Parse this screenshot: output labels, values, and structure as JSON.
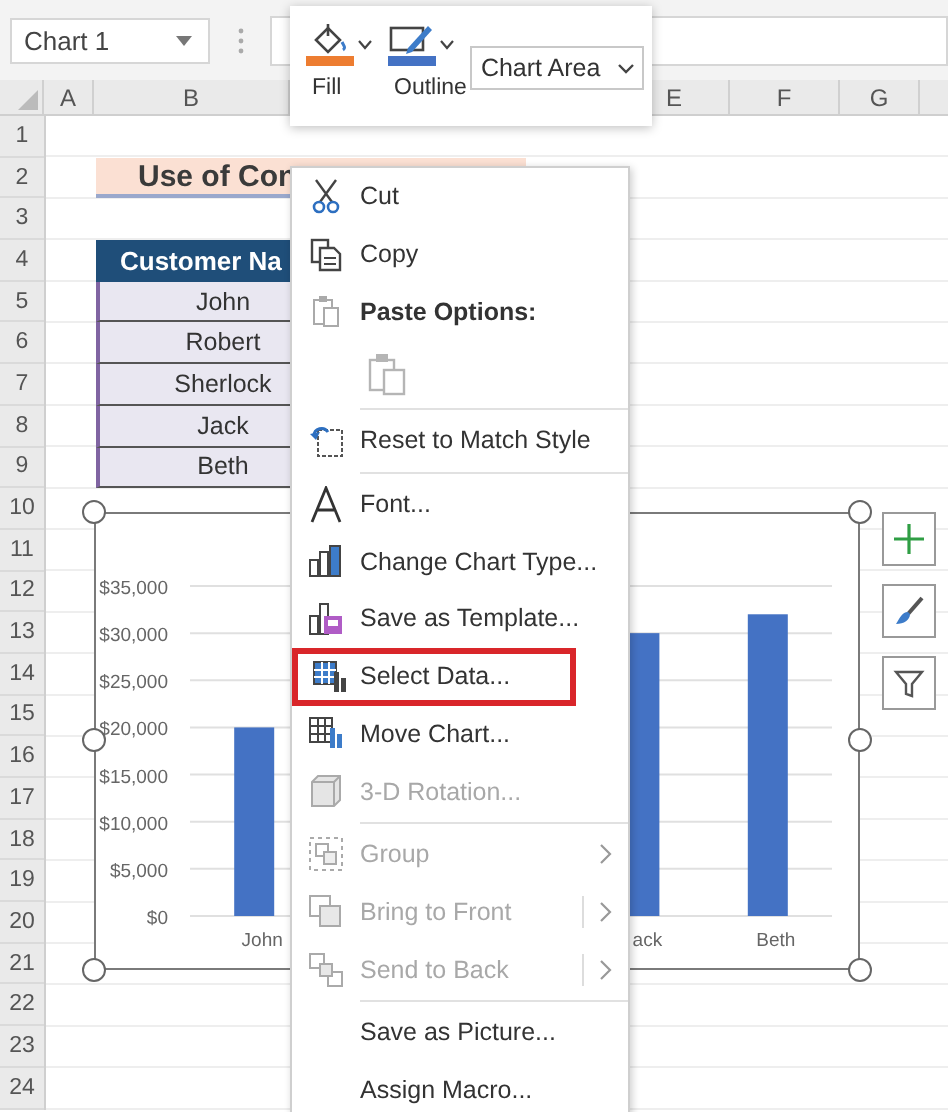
{
  "formula_bar": {
    "name_box": "Chart 1"
  },
  "mini_toolbar": {
    "buttons": [
      {
        "label": "Fill"
      },
      {
        "label": "Outline"
      }
    ],
    "element_dropdown": {
      "value": "Chart Area"
    }
  },
  "column_headers": [
    "A",
    "B",
    "E",
    "F",
    "G"
  ],
  "row_headers": [
    "1",
    "2",
    "3",
    "4",
    "5",
    "6",
    "7",
    "8",
    "9",
    "10",
    "11",
    "12",
    "13",
    "14",
    "15",
    "16",
    "17",
    "18",
    "19",
    "20",
    "21",
    "22",
    "23",
    "24"
  ],
  "sheet": {
    "title": "Use of Con",
    "table_header": "Customer Na",
    "names": [
      "John",
      "Robert",
      "Sherlock",
      "Jack",
      "Beth"
    ]
  },
  "chart": {
    "chart_data": {
      "type": "bar",
      "categories": [
        "John",
        null,
        null,
        "ack",
        "Beth"
      ],
      "values": [
        20000,
        null,
        null,
        30000,
        32000
      ],
      "ylim": [
        0,
        35000
      ],
      "grid": true,
      "yticks": [
        {
          "value": 0,
          "label": "$0"
        },
        {
          "value": 5000,
          "label": "$5,000"
        },
        {
          "value": 10000,
          "label": "$10,000"
        },
        {
          "value": 15000,
          "label": "$15,000"
        },
        {
          "value": 20000,
          "label": "$20,000"
        },
        {
          "value": 25000,
          "label": "$25,000"
        },
        {
          "value": 30000,
          "label": "$30,000"
        },
        {
          "value": 35000,
          "label": "$35,000"
        }
      ]
    }
  },
  "context_menu": {
    "items": [
      {
        "kind": "command",
        "label": "Cut",
        "disabled": false,
        "highlighted": false,
        "submenu": false
      },
      {
        "kind": "command",
        "label": "Copy",
        "disabled": false,
        "highlighted": false,
        "submenu": false
      },
      {
        "kind": "header",
        "label": "Paste Options:"
      },
      {
        "kind": "paste-option"
      },
      {
        "kind": "separator"
      },
      {
        "kind": "command",
        "label": "Reset to Match Style",
        "disabled": false,
        "highlighted": false,
        "submenu": false
      },
      {
        "kind": "separator"
      },
      {
        "kind": "command",
        "label": "Font...",
        "disabled": false,
        "highlighted": false,
        "submenu": false
      },
      {
        "kind": "command",
        "label": "Change Chart Type...",
        "disabled": false,
        "highlighted": false,
        "submenu": false
      },
      {
        "kind": "command",
        "label": "Save as Template...",
        "disabled": false,
        "highlighted": false,
        "submenu": false
      },
      {
        "kind": "command",
        "label": "Select Data...",
        "disabled": false,
        "highlighted": true,
        "submenu": false
      },
      {
        "kind": "command",
        "label": "Move Chart...",
        "disabled": false,
        "highlighted": false,
        "submenu": false
      },
      {
        "kind": "command",
        "label": "3-D Rotation...",
        "disabled": true,
        "highlighted": false,
        "submenu": false
      },
      {
        "kind": "separator"
      },
      {
        "kind": "command",
        "label": "Group",
        "disabled": true,
        "highlighted": false,
        "submenu": true
      },
      {
        "kind": "command",
        "label": "Bring to Front",
        "disabled": true,
        "highlighted": false,
        "submenu": true
      },
      {
        "kind": "command",
        "label": "Send to Back",
        "disabled": true,
        "highlighted": false,
        "submenu": true
      },
      {
        "kind": "separator"
      },
      {
        "kind": "command",
        "label": "Save as Picture...",
        "disabled": false,
        "highlighted": false,
        "submenu": false
      },
      {
        "kind": "command",
        "label": "Assign Macro...",
        "disabled": false,
        "highlighted": false,
        "submenu": false
      }
    ]
  }
}
